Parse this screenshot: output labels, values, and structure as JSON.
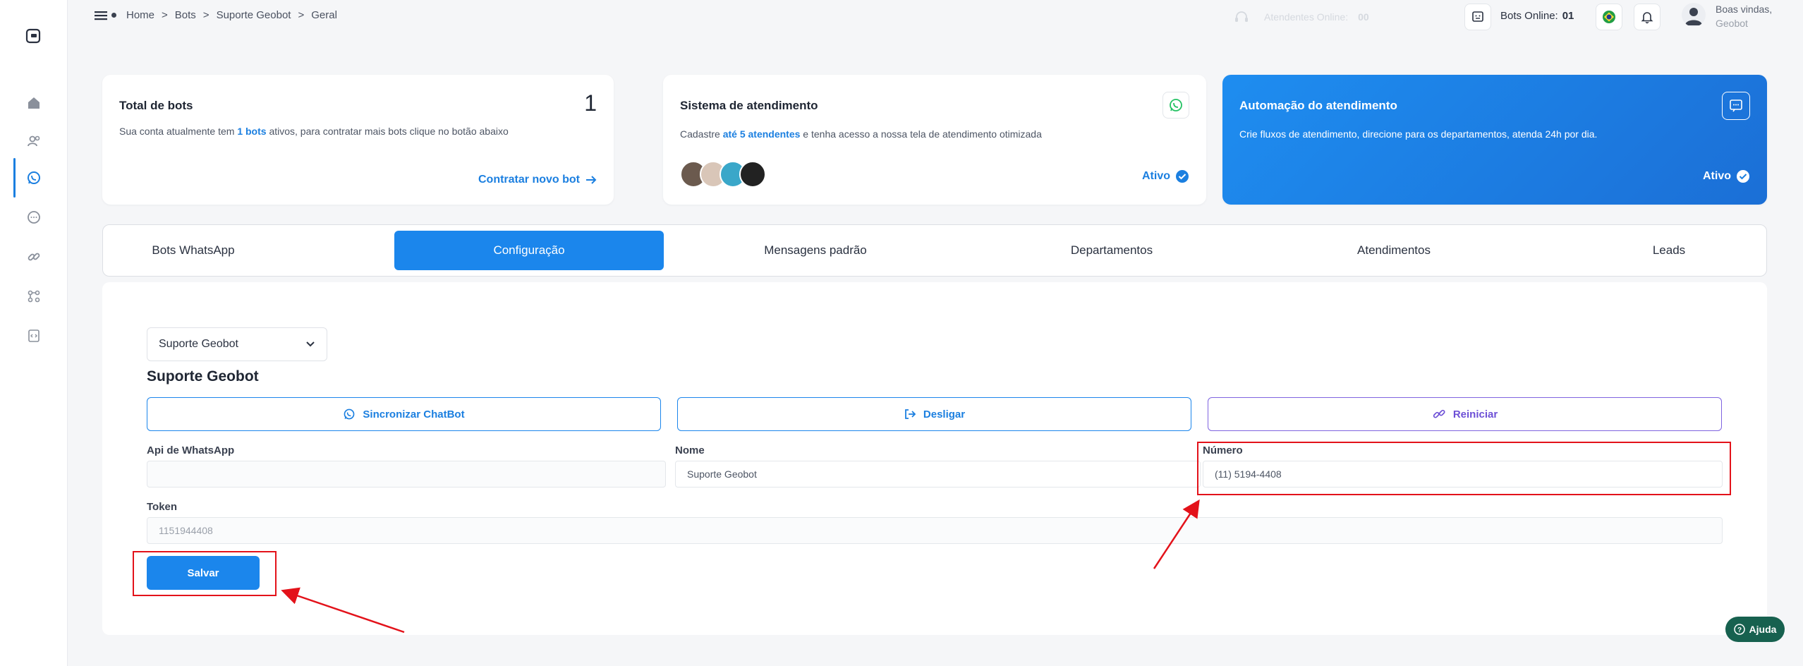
{
  "breadcrumb": {
    "items": [
      "Home",
      "Bots",
      "Suporte Geobot",
      "Geral"
    ],
    "separator": ">"
  },
  "topbar": {
    "attendants_label": "Atendentes Online:",
    "attendants_count": "00",
    "bots_label": "Bots Online:",
    "bots_count": "01",
    "welcome": "Boas vindas,",
    "user": "Geobot"
  },
  "cards": {
    "total": {
      "title": "Total de bots",
      "count": "1",
      "text_prefix": "Sua conta atualmente tem ",
      "text_bold": "1 bots",
      "text_suffix": " ativos, para contratar mais bots clique no botão abaixo",
      "link": "Contratar novo bot"
    },
    "sistema": {
      "title": "Sistema de atendimento",
      "text_prefix": "Cadastre ",
      "text_bold": "até 5 atendentes",
      "text_suffix": " e tenha acesso a nossa tela de atendimento otimizada",
      "status": "Ativo"
    },
    "automacao": {
      "title": "Automação do atendimento",
      "text": "Crie fluxos de atendimento, direcione para os departamentos, atenda 24h por dia.",
      "status": "Ativo"
    }
  },
  "tabs": [
    "Bots WhatsApp",
    "Configuração",
    "Mensagens padrão",
    "Departamentos",
    "Atendimentos",
    "Leads"
  ],
  "active_tab": "Configuração",
  "form": {
    "bot_select": "Suporte Geobot",
    "bot_title": "Suporte Geobot",
    "sync_button": "Sincronizar ChatBot",
    "disconnect_button": "Desligar",
    "restart_button": "Reiniciar",
    "api_label": "Api de WhatsApp",
    "api_value": "",
    "name_label": "Nome",
    "name_value": "Suporte Geobot",
    "number_label": "Número",
    "number_value": "(11) 5194-4408",
    "token_label": "Token",
    "token_value": "1151944408",
    "save_button": "Salvar"
  },
  "help_button": "Ajuda",
  "colors": {
    "primary": "#1b86ec",
    "annotation": "#e3121a",
    "help": "#17614f"
  }
}
